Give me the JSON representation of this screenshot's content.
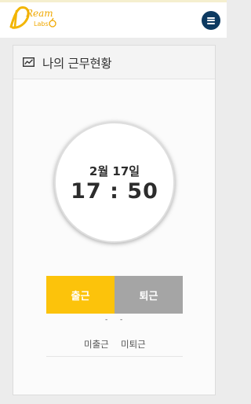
{
  "header": {
    "logo_text": "DReam Labs",
    "menu_icon": "hamburger-icon",
    "menu_button_color": "#0d3a61"
  },
  "card": {
    "icon": "line-chart-icon",
    "title": "나의 근무현황"
  },
  "clock": {
    "date": "2월 17일",
    "time": "17 : 50"
  },
  "actions": {
    "check_in_label": "출근",
    "check_out_label": "퇴근",
    "check_in_color": "#fcc30b",
    "check_out_color": "#a5a5a5"
  },
  "status": {
    "check_in_time": "-",
    "check_out_time": "-",
    "check_in_status": "미출근",
    "check_out_status": "미퇴근"
  }
}
